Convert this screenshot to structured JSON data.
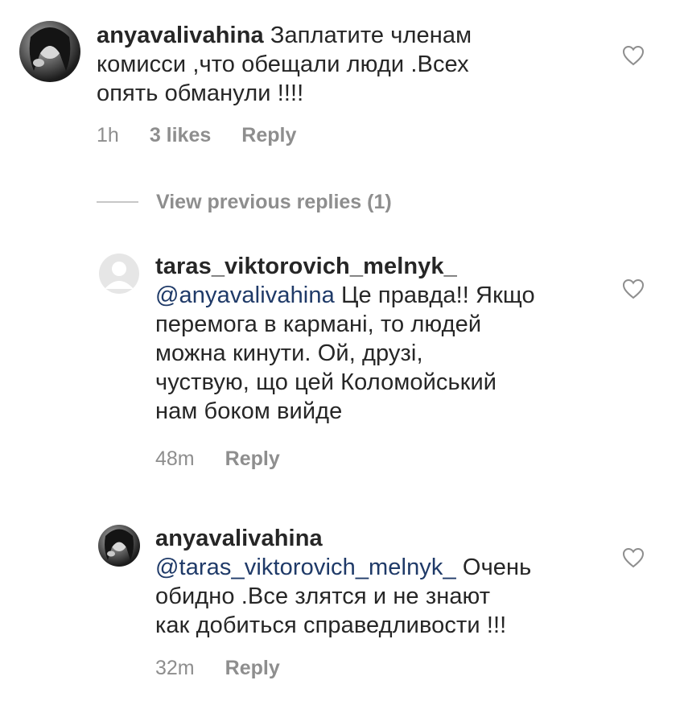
{
  "comments": [
    {
      "username": "anyavalivahina",
      "text": "Заплатите членам комисси ,что обещали люди .Всех опять обманули !!!!",
      "line1_rest": " Заплатите членам",
      "line2": "комисси ,что обещали люди .Всех",
      "line3": "опять обманули !!!!",
      "time": "1h",
      "likes": "3 likes",
      "reply_label": "Reply"
    }
  ],
  "view_previous_replies": "View previous replies (1)",
  "replies": [
    {
      "username": "taras_viktorovich_melnyk_",
      "mention": "@anyavalivahina",
      "line1_rest": " Це правда!! Якщо",
      "line2": "перемога в  кармані, то людей",
      "line3": "можна  кинути. Ой, друзі,",
      "line4": "чуствую, що цей Коломойський",
      "line5": "нам боком вийде",
      "time": "48m",
      "reply_label": "Reply"
    },
    {
      "username": "anyavalivahina",
      "mention": "@taras_viktorovich_melnyk_",
      "line1_rest": "  Очень",
      "line2": "обидно .Все  злятся и не знают",
      "line3": "как добиться справедливости !!!",
      "time": "32m",
      "reply_label": "Reply"
    }
  ],
  "icons": {
    "like": "heart-outline-icon",
    "avatar_default": "person-placeholder-icon"
  },
  "colors": {
    "text": "#262626",
    "meta": "#8e8e8e",
    "mention": "#1f3a68"
  }
}
